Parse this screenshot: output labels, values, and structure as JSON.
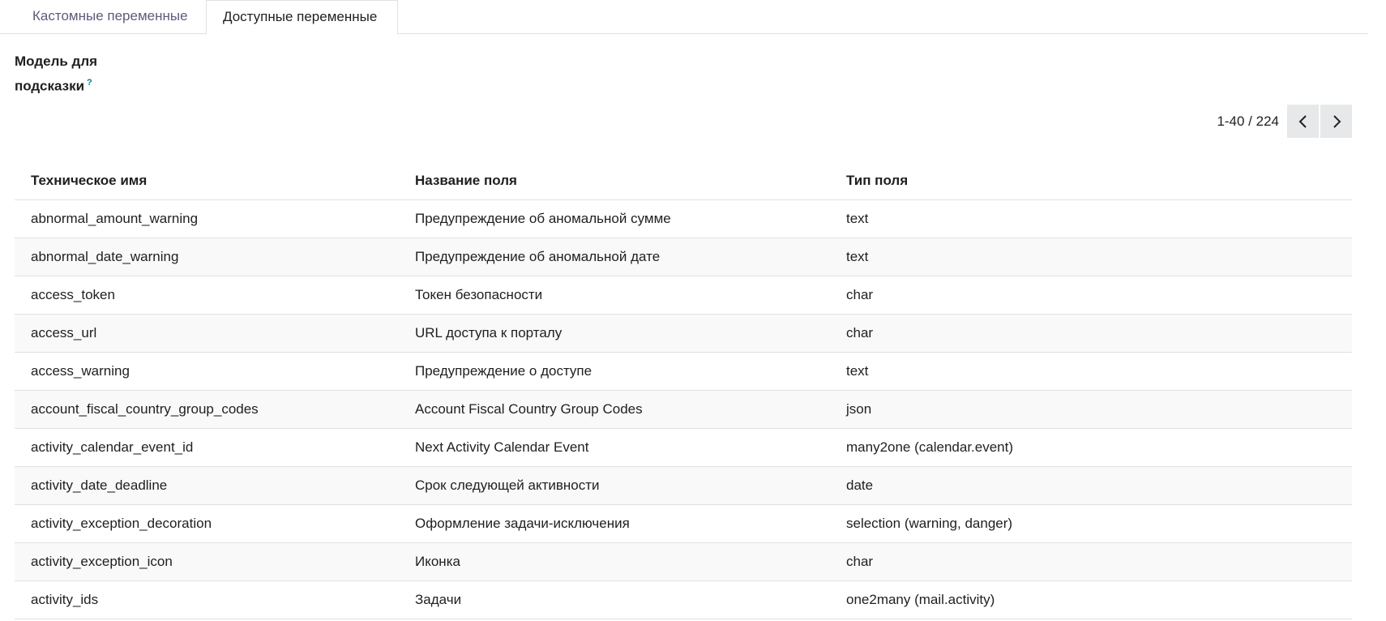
{
  "tabs": {
    "custom_label": "Кастомные переменные",
    "available_label": "Доступные переменные"
  },
  "model": {
    "label_line1": "Модель для",
    "label_line2": "подсказки",
    "help": "?"
  },
  "pager": {
    "value": "1-40 / 224"
  },
  "table": {
    "headers": {
      "technical_name": "Техническое имя",
      "field_name": "Название поля",
      "field_type": "Тип поля"
    },
    "rows": [
      {
        "technical_name": "abnormal_amount_warning",
        "field_name": "Предупреждение об аномальной сумме",
        "field_type": "text"
      },
      {
        "technical_name": "abnormal_date_warning",
        "field_name": "Предупреждение об аномальной дате",
        "field_type": "text"
      },
      {
        "technical_name": "access_token",
        "field_name": "Токен безопасности",
        "field_type": "char"
      },
      {
        "technical_name": "access_url",
        "field_name": "URL доступа к порталу",
        "field_type": "char"
      },
      {
        "technical_name": "access_warning",
        "field_name": "Предупреждение о доступе",
        "field_type": "text"
      },
      {
        "technical_name": "account_fiscal_country_group_codes",
        "field_name": "Account Fiscal Country Group Codes",
        "field_type": "json"
      },
      {
        "technical_name": "activity_calendar_event_id",
        "field_name": "Next Activity Calendar Event",
        "field_type": "many2one (calendar.event)"
      },
      {
        "technical_name": "activity_date_deadline",
        "field_name": "Срок следующей активности",
        "field_type": "date"
      },
      {
        "technical_name": "activity_exception_decoration",
        "field_name": "Оформление задачи-исключения",
        "field_type": "selection (warning, danger)"
      },
      {
        "technical_name": "activity_exception_icon",
        "field_name": "Иконка",
        "field_type": "char"
      },
      {
        "technical_name": "activity_ids",
        "field_name": "Задачи",
        "field_type": "one2many (mail.activity)"
      }
    ]
  },
  "icons": {
    "prev": "chevron-left-icon",
    "next": "chevron-right-icon"
  },
  "colors": {
    "tab_inactive_text": "#5f5a7a",
    "help_mark": "#017e84",
    "pager_button_bg": "#e6e8ea",
    "row_stripe": "#f9f9f9",
    "border": "#dee2e6"
  }
}
